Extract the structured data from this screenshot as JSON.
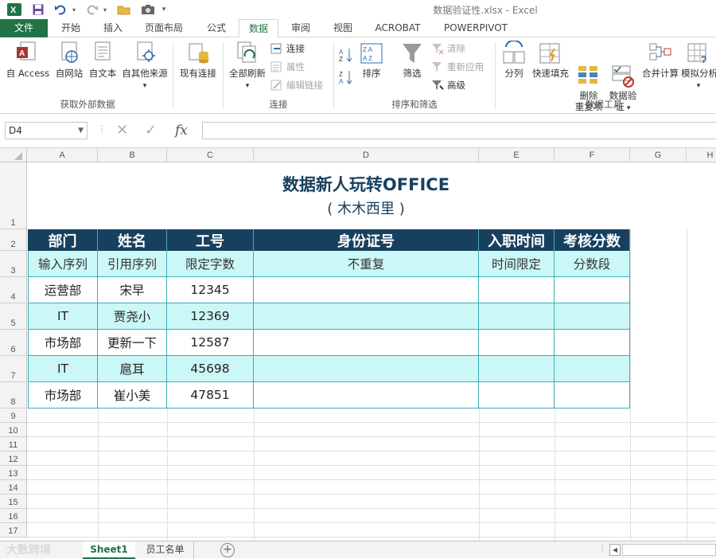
{
  "window": {
    "title": "数据验证性.xlsx - Excel"
  },
  "quick_access": [
    "excel-logo-icon",
    "save-icon",
    "undo-icon",
    "redo-icon",
    "open-folder-icon",
    "camera-icon"
  ],
  "tabs": [
    {
      "label": "文件",
      "id": "file"
    },
    {
      "label": "开始",
      "id": "home"
    },
    {
      "label": "插入",
      "id": "insert"
    },
    {
      "label": "页面布局",
      "id": "page-layout"
    },
    {
      "label": "公式",
      "id": "formulas"
    },
    {
      "label": "数据",
      "id": "data"
    },
    {
      "label": "审阅",
      "id": "review"
    },
    {
      "label": "视图",
      "id": "view"
    },
    {
      "label": "ACROBAT",
      "id": "acrobat"
    },
    {
      "label": "POWERPIVOT",
      "id": "powerpivot"
    }
  ],
  "ribbon": {
    "external_data": {
      "label": "获取外部数据",
      "buttons": [
        "自 Access",
        "自网站",
        "自文本",
        "自其他来源"
      ]
    },
    "existing_connections": "现有连接",
    "refresh_all": "全部刷新",
    "connections": {
      "label": "连接",
      "items": [
        "连接",
        "属性",
        "编辑链接"
      ]
    },
    "sort_filter": {
      "label": "排序和筛选",
      "sort": "排序",
      "filter": "筛选",
      "items": [
        "清除",
        "重新应用",
        "高级"
      ]
    },
    "data_tools": {
      "label": "数据工具",
      "buttons": [
        "分列",
        "快速填充",
        "删除\n重复项",
        "数据验\n证",
        "合并计算",
        "模拟分析"
      ]
    }
  },
  "formula_bar": {
    "name_box": "D4",
    "formula": "",
    "fx": "fx"
  },
  "sheet": {
    "columns": [
      "A",
      "B",
      "C",
      "D",
      "E",
      "F",
      "G",
      "H"
    ],
    "rows": [
      "1",
      "2",
      "3",
      "4",
      "5",
      "6",
      "7",
      "8",
      "9",
      "10",
      "11",
      "12",
      "13",
      "14",
      "15",
      "16",
      "17"
    ],
    "title": "数据新人玩转OFFICE",
    "subtitle": "( 木木西里 )",
    "headers": [
      "部门",
      "姓名",
      "工号",
      "身份证号",
      "入职时间",
      "考核分数"
    ],
    "rules": [
      "输入序列",
      "引用序列",
      "限定字数",
      "不重复",
      "时间限定",
      "分数段"
    ],
    "records": [
      [
        "运营部",
        "宋早",
        "12345",
        "",
        "",
        ""
      ],
      [
        "IT",
        "贾尧小",
        "12369",
        "",
        "",
        ""
      ],
      [
        "市场部",
        "更新一下",
        "12587",
        "",
        "",
        ""
      ],
      [
        "IT",
        "扈耳",
        "45698",
        "",
        "",
        ""
      ],
      [
        "市场部",
        "崔小美",
        "47851",
        "",
        "",
        ""
      ]
    ]
  },
  "sheet_tabs": [
    "Sheet1",
    "员工名单"
  ],
  "watermark": "大数跨境"
}
